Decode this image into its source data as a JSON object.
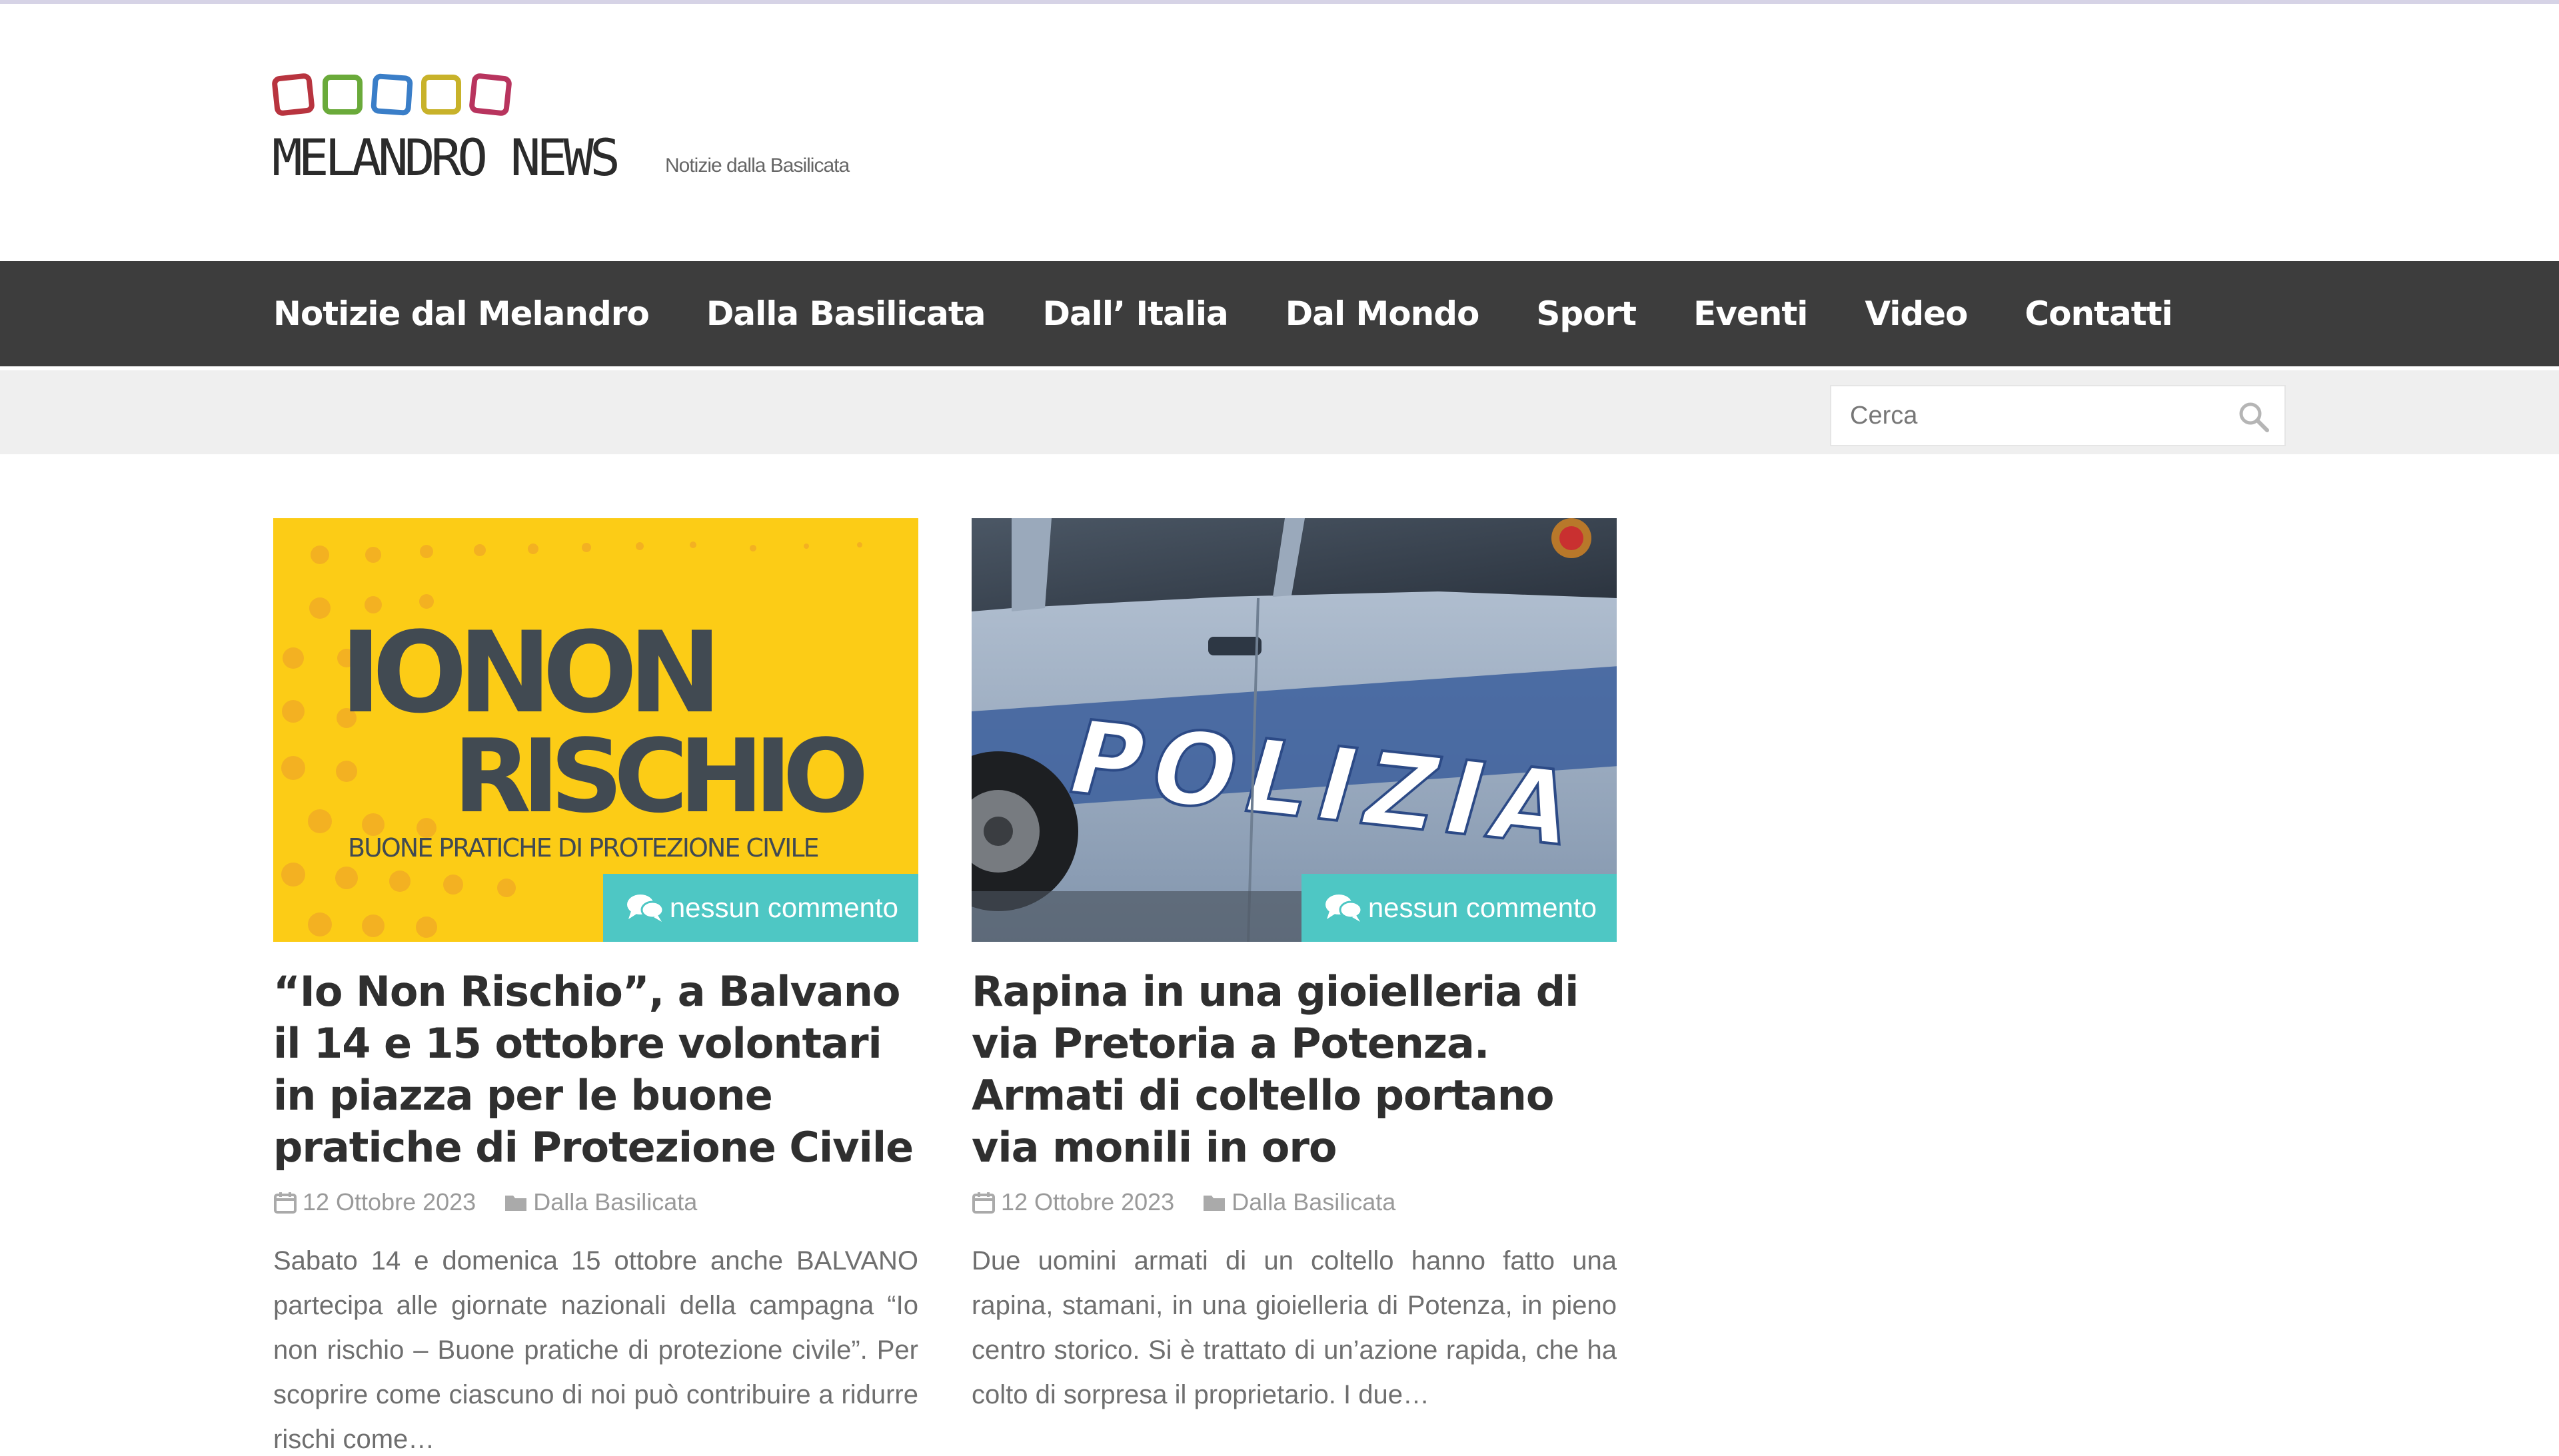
{
  "header": {
    "site_name": "MELANDRO NEWS",
    "tagline": "Notizie dalla Basilicata",
    "logo_colors": [
      "#b8343f",
      "#6aaa3a",
      "#3a7ec8",
      "#c8b22a",
      "#b8345e"
    ]
  },
  "nav": {
    "items": [
      {
        "label": "Notizie dal Melandro"
      },
      {
        "label": "Dalla Basilicata"
      },
      {
        "label": "Dall’ Italia"
      },
      {
        "label": "Dal Mondo"
      },
      {
        "label": "Sport"
      },
      {
        "label": "Eventi"
      },
      {
        "label": "Video"
      },
      {
        "label": "Contatti"
      }
    ]
  },
  "search": {
    "placeholder": "Cerca",
    "icon": "search-icon"
  },
  "articles": [
    {
      "image": {
        "line1": "IONON",
        "line2": "RISCHIO",
        "subtitle": "BUONE PRATICHE DI PROTEZIONE CIVILE",
        "bg_color": "#fccc16"
      },
      "comments_label": "nessun commento",
      "title": "“Io Non Rischio”, a Balvano il 14 e 15 ottobre volontari in piazza per le buone pratiche di Protezione Civile",
      "date": "12 Ottobre 2023",
      "category": "Dalla Basilicata",
      "excerpt": "Sabato 14 e domenica 15 ottobre anche BALVANO partecipa alle giornate nazionali della campagna “Io non rischio – Buone pratiche di protezione civile”. Per scoprire come ciascuno di noi può contribuire a ridurre rischi come…"
    },
    {
      "image": {
        "car_text": "POLIZIA"
      },
      "comments_label": "nessun commento",
      "title": "Rapina in una gioielleria di via Pretoria a Potenza. Armati di coltello portano via monili in oro",
      "date": "12 Ottobre 2023",
      "category": "Dalla Basilicata",
      "excerpt": "Due uomini armati di un coltello hanno fatto una rapina, stamani, in una gioielleria di Potenza, in pieno centro storico. Si è trattato di un’azione rapida, che ha colto di sorpresa il proprietario. I due…"
    }
  ],
  "colors": {
    "nav_bg": "#3d3d3d",
    "accent": "#4ec7c4",
    "search_strip": "#efefef"
  }
}
